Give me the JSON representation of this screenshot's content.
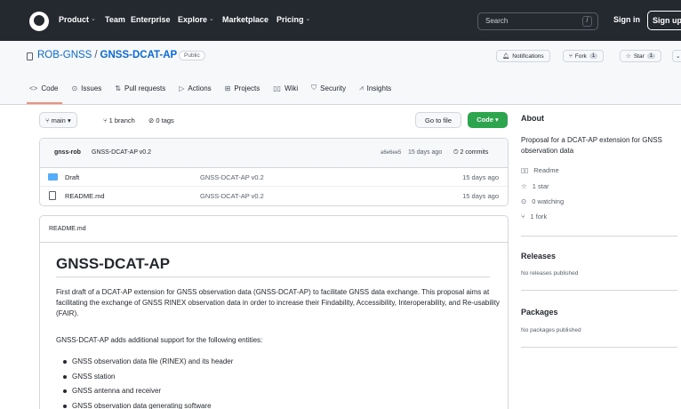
{
  "nav": {
    "items": [
      "Product",
      "Team",
      "Enterprise",
      "Explore",
      "Marketplace",
      "Pricing"
    ],
    "search_placeholder": "Search",
    "slash": "/",
    "sign_in": "Sign in",
    "sign_up": "Sign up"
  },
  "repo": {
    "owner": "ROB-GNSS",
    "sep": "/",
    "name": "GNSS-DCAT-AP",
    "visibility": "Public",
    "notifications": "Notifications",
    "fork": "Fork",
    "fork_count": "1",
    "star": "Star",
    "star_count": "1"
  },
  "tabs": [
    {
      "icon": "<>",
      "label": "Code"
    },
    {
      "icon": "⊙",
      "label": "Issues"
    },
    {
      "icon": "⇅",
      "label": "Pull requests"
    },
    {
      "icon": "▷",
      "label": "Actions"
    },
    {
      "icon": "⊞",
      "label": "Projects"
    },
    {
      "icon": "▯▯",
      "label": "Wiki"
    },
    {
      "icon": "⛉",
      "label": "Security"
    },
    {
      "icon": "⩘",
      "label": "Insights"
    }
  ],
  "toolbar": {
    "branch": "main",
    "branches": "1 branch",
    "tags": "0 tags",
    "go_to_file": "Go to file",
    "code": "Code"
  },
  "commit": {
    "author": "gnss-rob",
    "message": "GNSS-DCAT-AP v0.2",
    "hash": "a6e6ee5",
    "time": "15 days ago",
    "commits": "2 commits"
  },
  "files": [
    {
      "name": "Draft",
      "type": "folder",
      "message": "GNSS-DCAT-AP v0.2",
      "date": "15 days ago"
    },
    {
      "name": "README.md",
      "type": "file",
      "message": "GNSS-DCAT-AP v0.2",
      "date": "15 days ago"
    }
  ],
  "readme": {
    "filename": "README.md",
    "title": "GNSS-DCAT-AP",
    "para1": "First draft of a DCAT-AP extension for GNSS observation data (GNSS-DCAT-AP) to facilitate GNSS data exchange. This proposal aims at facilitating the exchange of GNSS RINEX observation data in order to increase their Findability, Accessibility, Interoperability, and Re-usability (FAIR).",
    "para2": "GNSS-DCAT-AP adds additional support for the following entities:",
    "bullets": [
      "GNSS observation data file (RINEX) and its header",
      "GNSS station",
      "GNSS antenna and receiver",
      "GNSS observation data generating software"
    ]
  },
  "about": {
    "heading": "About",
    "description": "Proposal for a DCAT-AP extension for GNSS observation data",
    "readme": "Readme",
    "stars": "1 star",
    "watching": "0 watching",
    "forks": "1 fork"
  },
  "releases": {
    "heading": "Releases",
    "text": "No releases published"
  },
  "packages": {
    "heading": "Packages",
    "text": "No packages published"
  }
}
